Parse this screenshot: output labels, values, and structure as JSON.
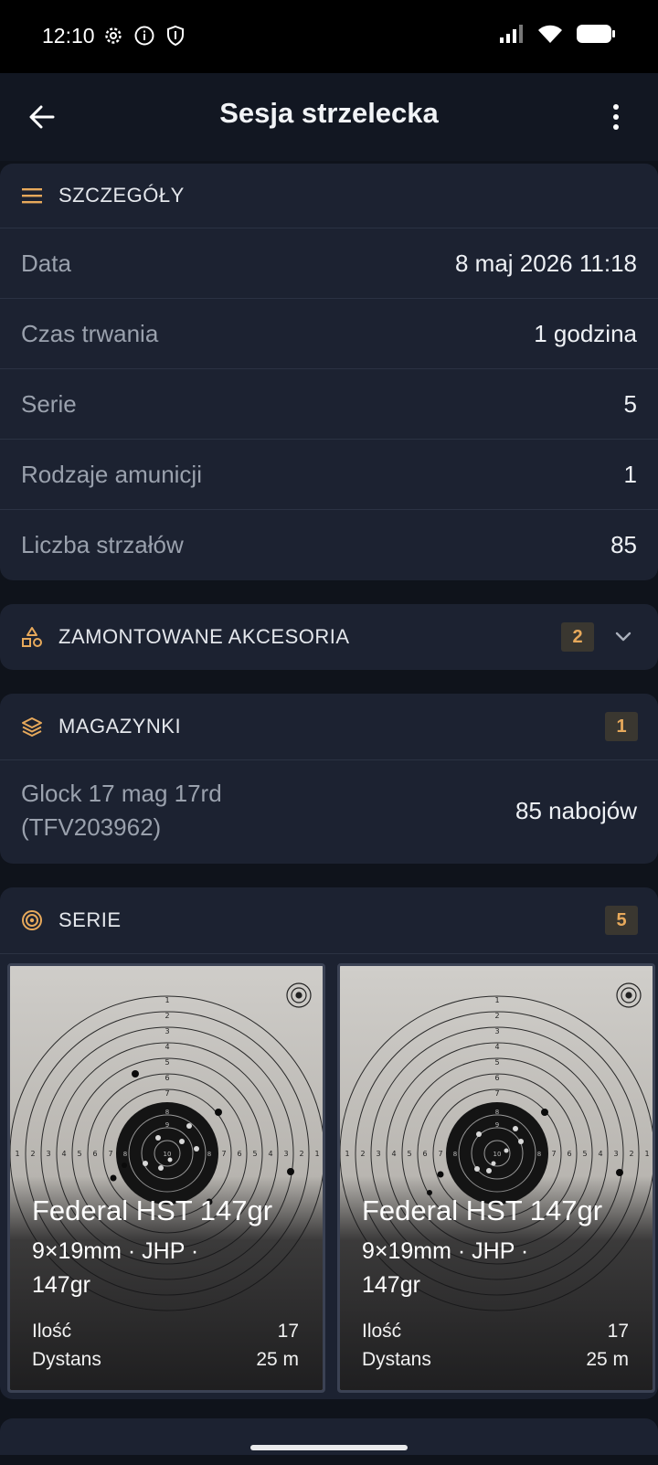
{
  "status_bar": {
    "time": "12:10"
  },
  "app_bar": {
    "title": "Sesja strzelecka"
  },
  "details": {
    "title": "SZCZEGÓŁY",
    "rows": [
      {
        "label": "Data",
        "value": "8 maj 2026 11:18"
      },
      {
        "label": "Czas trwania",
        "value": "1 godzina"
      },
      {
        "label": "Serie",
        "value": "5"
      },
      {
        "label": "Rodzaje amunicji",
        "value": "1"
      },
      {
        "label": "Liczba strzałów",
        "value": "85"
      }
    ]
  },
  "accessories": {
    "title": "ZAMONTOWANE AKCESORIA",
    "count": "2"
  },
  "magazines": {
    "title": "MAGAZYNKI",
    "count": "1",
    "items": [
      {
        "name": "Glock 17 mag 17rd (TFV203962)",
        "value": "85 nabojów"
      }
    ]
  },
  "series": {
    "title": "SERIE",
    "count": "5",
    "tiles": [
      {
        "ammo": "Federal HST 147gr",
        "specs": "9×19mm · JHP · 147gr",
        "qty_label": "Ilość",
        "qty": "17",
        "dist_label": "Dystans",
        "dist": "25 m"
      },
      {
        "ammo": "Federal HST 147gr",
        "specs": "9×19mm · JHP · 147gr",
        "qty_label": "Ilość",
        "qty": "17",
        "dist_label": "Dystans",
        "dist": "25 m"
      }
    ]
  },
  "colors": {
    "accent": "#e7a95b",
    "card": "#1c2231",
    "background": "#0f131b"
  }
}
